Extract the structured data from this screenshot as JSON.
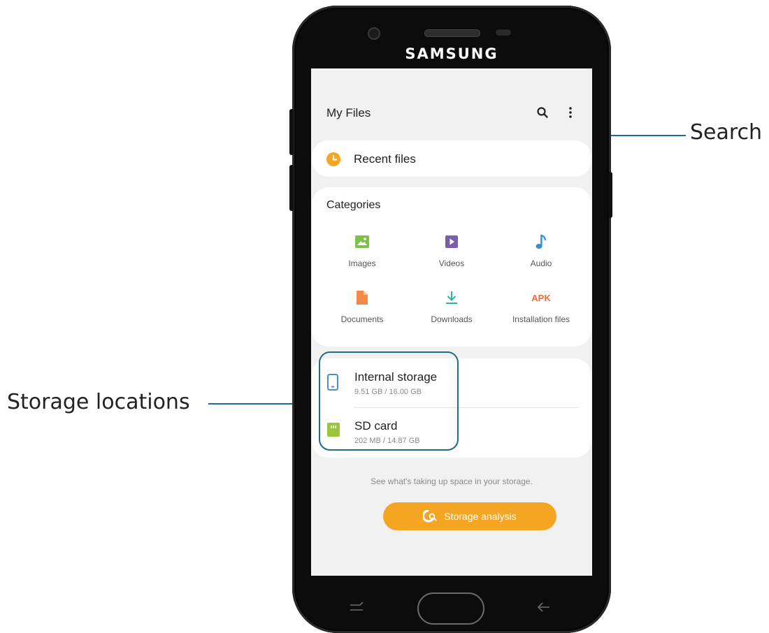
{
  "callouts": {
    "search": "Search",
    "storage": "Storage locations"
  },
  "device": {
    "brand": "SAMSUNG"
  },
  "app": {
    "title": "My Files"
  },
  "recent": {
    "label": "Recent files",
    "icon": "clock-icon",
    "color": "#f4a623"
  },
  "categories": {
    "title": "Categories",
    "items": [
      {
        "label": "Images",
        "icon": "image-icon",
        "color": "#7cc14a"
      },
      {
        "label": "Videos",
        "icon": "video-icon",
        "color": "#7b5ea8"
      },
      {
        "label": "Audio",
        "icon": "music-note-icon",
        "color": "#2f8fd8"
      },
      {
        "label": "Documents",
        "icon": "document-icon",
        "color": "#f28b4a"
      },
      {
        "label": "Downloads",
        "icon": "download-icon",
        "color": "#2bb3a0"
      },
      {
        "label": "Installation files",
        "icon": "apk-icon",
        "glyph": "APK",
        "color": "#f26a3d"
      }
    ]
  },
  "storage": {
    "items": [
      {
        "name": "Internal storage",
        "size": "9.51 GB / 16.00 GB",
        "icon": "phone-storage-icon",
        "color": "#4a8fd6"
      },
      {
        "name": "SD card",
        "size": "202 MB / 14.87 GB",
        "icon": "sd-card-icon",
        "color": "#9bc53d"
      }
    ]
  },
  "analysis": {
    "hint": "See what's taking up space in your storage.",
    "button_label": "Storage analysis",
    "color": "#f4a623"
  }
}
